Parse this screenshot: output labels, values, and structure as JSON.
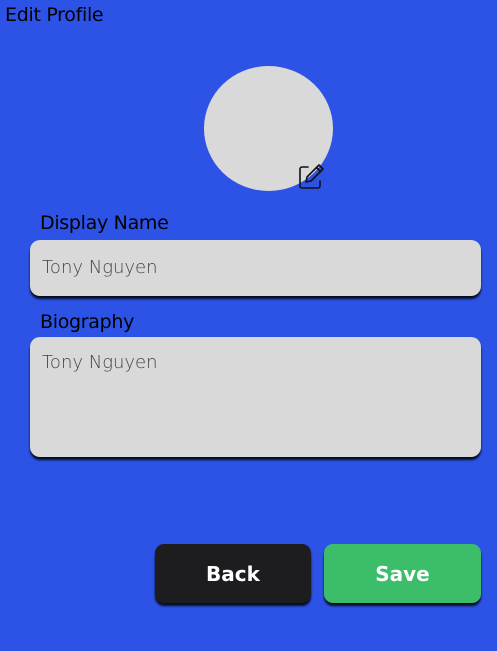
{
  "header": {
    "title": "Edit Profile"
  },
  "avatar": {
    "edit_icon": "edit-pencil-icon"
  },
  "form": {
    "display_name_label": "Display Name",
    "display_name_value": "Tony Nguyen",
    "biography_label": "Biography",
    "biography_value": "Tony Nguyen"
  },
  "actions": {
    "back_label": "Back",
    "save_label": "Save"
  },
  "colors": {
    "background": "#2c53e6",
    "field": "#d9d9d9",
    "back_button": "#1d1d1f",
    "save_button": "#3bbd6a"
  }
}
